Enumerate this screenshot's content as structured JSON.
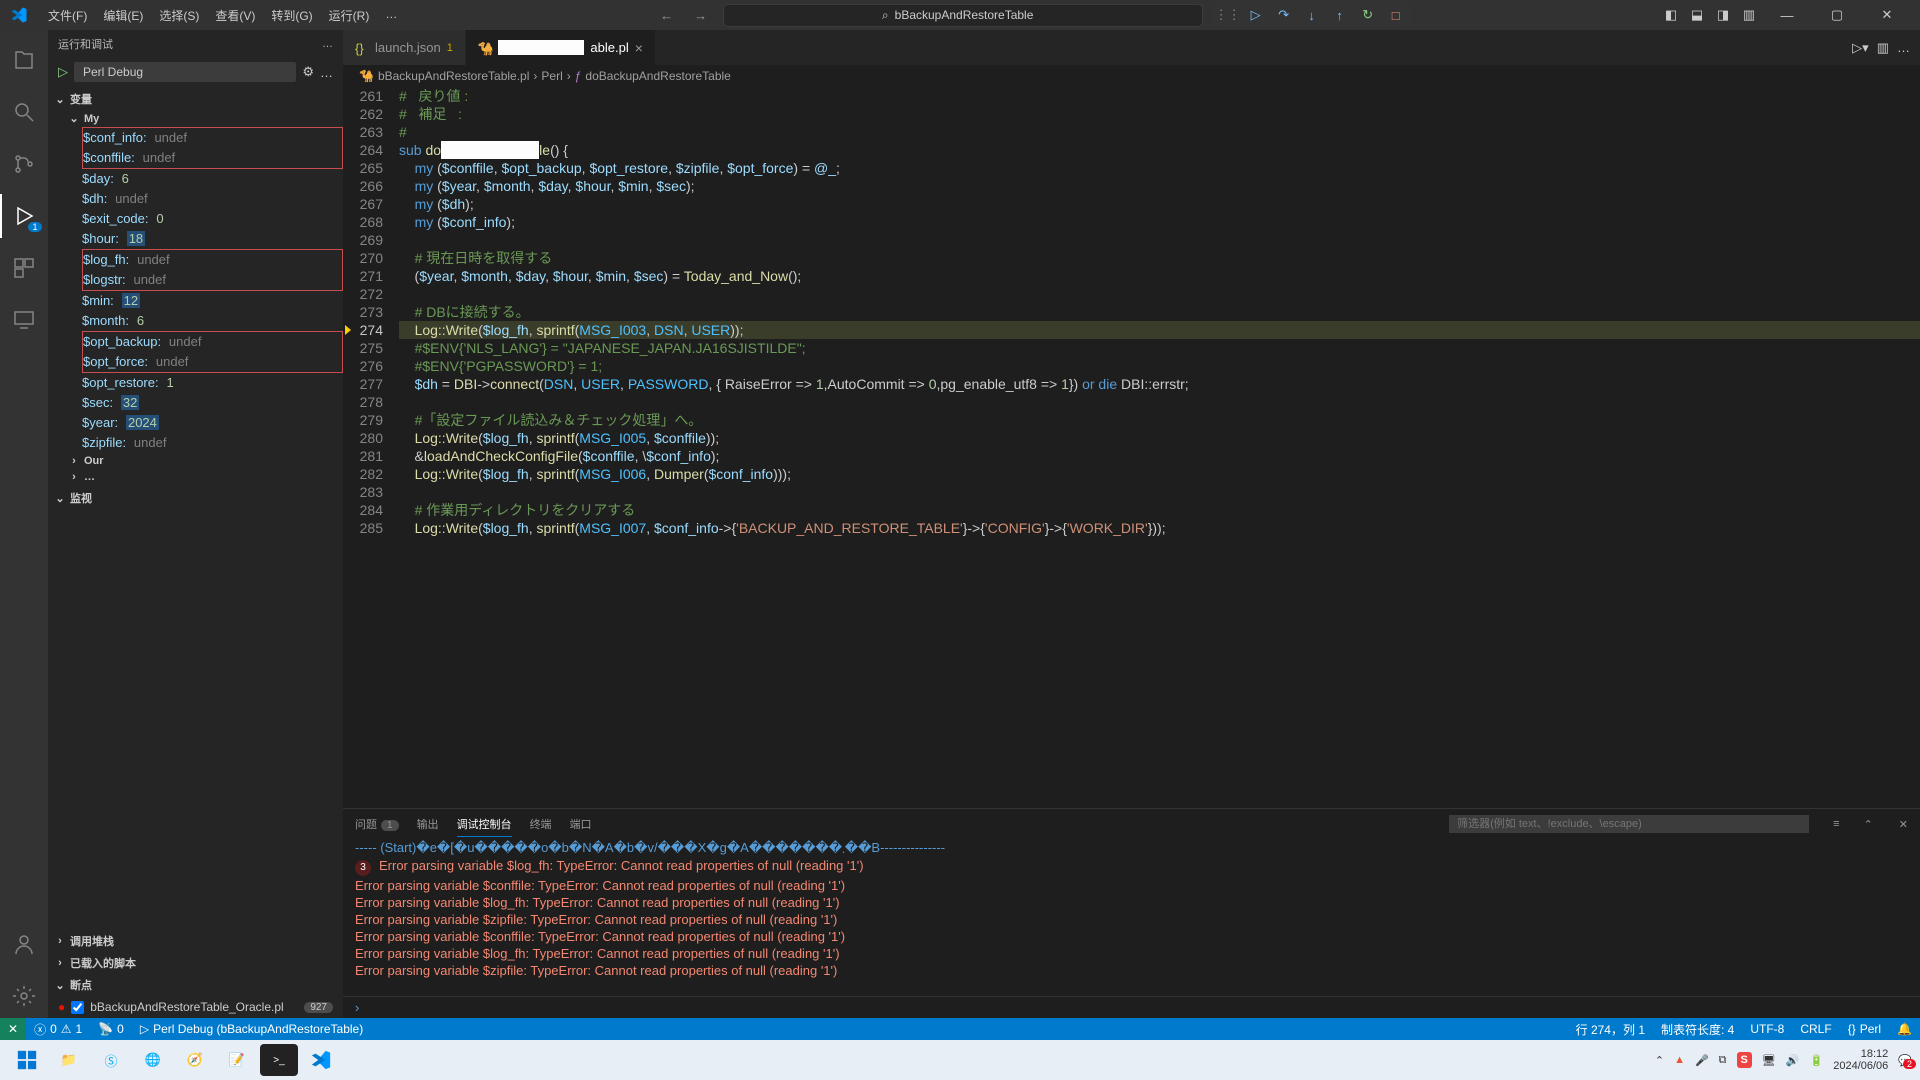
{
  "titlebar": {
    "menus": [
      "文件(F)",
      "编辑(E)",
      "选择(S)",
      "查看(V)",
      "转到(G)",
      "运行(R)",
      "…"
    ],
    "search_text": "bBackupAndRestoreTable"
  },
  "sidebar": {
    "title": "运行和调试",
    "config": "Perl Debug",
    "sections": {
      "variables": "变量",
      "my": "My",
      "our": "Our",
      "watch": "监视",
      "callstack": "调用堆栈",
      "loaded": "已载入的脚本",
      "breakpoints": "断点"
    },
    "vars": [
      {
        "n": "$conf_info",
        "v": "undef",
        "t": "undef",
        "box": "top"
      },
      {
        "n": "$conffile",
        "v": "undef",
        "t": "undef",
        "box": "bot"
      },
      {
        "n": "$day",
        "v": "6",
        "t": "num"
      },
      {
        "n": "$dh",
        "v": "undef",
        "t": "undef"
      },
      {
        "n": "$exit_code",
        "v": "0",
        "t": "num"
      },
      {
        "n": "$hour",
        "v": "18",
        "t": "num",
        "hl": true
      },
      {
        "n": "$log_fh",
        "v": "undef",
        "t": "undef",
        "box": "top"
      },
      {
        "n": "$logstr",
        "v": "undef",
        "t": "undef",
        "box": "bot"
      },
      {
        "n": "$min",
        "v": "12",
        "t": "num",
        "hl": true
      },
      {
        "n": "$month",
        "v": "6",
        "t": "num"
      },
      {
        "n": "$opt_backup",
        "v": "undef",
        "t": "undef",
        "box": "top"
      },
      {
        "n": "$opt_force",
        "v": "undef",
        "t": "undef",
        "box": "bot"
      },
      {
        "n": "$opt_restore",
        "v": "1",
        "t": "num"
      },
      {
        "n": "$sec",
        "v": "32",
        "t": "num",
        "hl": true
      },
      {
        "n": "$year",
        "v": "2024",
        "t": "num",
        "hl": true
      },
      {
        "n": "$zipfile",
        "v": "undef",
        "t": "undef"
      }
    ],
    "breakpoint_file": "bBackupAndRestoreTable_Oracle.pl",
    "breakpoint_count": "927"
  },
  "tabs": [
    {
      "icon": "json",
      "label": "launch.json",
      "mod": "1",
      "active": false
    },
    {
      "icon": "perl",
      "label": "able.pl",
      "active": true,
      "close": true,
      "masked": true
    }
  ],
  "breadcrumb": [
    "bBackupAndRestoreTable.pl",
    "Perl",
    "doBackupAndRestoreTable"
  ],
  "code": {
    "start": 261,
    "current": 274,
    "lines": [
      {
        "n": 261,
        "h": "<span class='k-com'>#   戻り値 :</span>"
      },
      {
        "n": 262,
        "h": "<span class='k-com'>#   補足   :</span>"
      },
      {
        "n": 263,
        "h": "<span class='k-com'>#</span>"
      },
      {
        "n": 264,
        "h": "<span class='k-blue'>sub</span> <span class='k-fn'>do</span><span class='whitebox'>============</span><span class='k-fn'>le</span>() {"
      },
      {
        "n": 265,
        "h": "    <span class='k-blue'>my</span> (<span class='k-var'>$conffile</span>, <span class='k-var'>$opt_backup</span>, <span class='k-var'>$opt_restore</span>, <span class='k-var'>$zipfile</span>, <span class='k-var'>$opt_force</span>) = <span class='k-var'>@_</span>;"
      },
      {
        "n": 266,
        "h": "    <span class='k-blue'>my</span> (<span class='k-var'>$year</span>, <span class='k-var'>$month</span>, <span class='k-var'>$day</span>, <span class='k-var'>$hour</span>, <span class='k-var'>$min</span>, <span class='k-var'>$sec</span>);"
      },
      {
        "n": 267,
        "h": "    <span class='k-blue'>my</span> (<span class='k-var'>$dh</span>);"
      },
      {
        "n": 268,
        "h": "    <span class='k-blue'>my</span> (<span class='k-var'>$conf_info</span>);"
      },
      {
        "n": 269,
        "h": ""
      },
      {
        "n": 270,
        "h": "    <span class='k-com'># 現在日時を取得する</span>"
      },
      {
        "n": 271,
        "h": "    (<span class='k-var'>$year</span>, <span class='k-var'>$month</span>, <span class='k-var'>$day</span>, <span class='k-var'>$hour</span>, <span class='k-var'>$min</span>, <span class='k-var'>$sec</span>) = <span class='k-fn'>Today_and_Now</span>();"
      },
      {
        "n": 272,
        "h": ""
      },
      {
        "n": 273,
        "h": "    <span class='k-com'># DBに接続する。</span>"
      },
      {
        "n": 274,
        "h": "    <span class='k-fn'>Log::Write</span>(<span class='k-var'>$log_fh</span>, <span class='k-fn'>sprintf</span>(<span class='k-const'>MSG_I003</span>, <span class='k-const'>DSN</span>, <span class='k-const'>USER</span>));",
        "cur": true
      },
      {
        "n": 275,
        "h": "    <span class='k-com'>#$ENV{'NLS_LANG'} = \"JAPANESE_JAPAN.JA16SJISTILDE\";</span>"
      },
      {
        "n": 276,
        "h": "    <span class='k-com'>#$ENV{'PGPASSWORD'} = 1;</span>"
      },
      {
        "n": 277,
        "h": "    <span class='k-var'>$dh</span> = <span class='k-fn'>DBI</span>-><span class='k-fn'>connect</span>(<span class='k-const'>DSN</span>, <span class='k-const'>USER</span>, <span class='k-const'>PASSWORD</span>, { RaiseError => <span class='k-num'>1</span>,AutoCommit => <span class='k-num'>0</span>,pg_enable_utf8 => <span class='k-num'>1</span>}) <span class='k-blue'>or die</span> DBI::errstr;"
      },
      {
        "n": 278,
        "h": ""
      },
      {
        "n": 279,
        "h": "    <span class='k-com'>#「設定ファイル読込み＆チェック処理」へ。</span>"
      },
      {
        "n": 280,
        "h": "    <span class='k-fn'>Log::Write</span>(<span class='k-var'>$log_fh</span>, <span class='k-fn'>sprintf</span>(<span class='k-const'>MSG_I005</span>, <span class='k-var'>$conffile</span>));"
      },
      {
        "n": 281,
        "h": "    &<span class='k-fn'>loadAndCheckConfigFile</span>(<span class='k-var'>$conffile</span>, \\<span class='k-var'>$conf_info</span>);"
      },
      {
        "n": 282,
        "h": "    <span class='k-fn'>Log::Write</span>(<span class='k-var'>$log_fh</span>, <span class='k-fn'>sprintf</span>(<span class='k-const'>MSG_I006</span>, <span class='k-fn'>Dumper</span>(<span class='k-var'>$conf_info</span>)));"
      },
      {
        "n": 283,
        "h": ""
      },
      {
        "n": 284,
        "h": "    <span class='k-com'># 作業用ディレクトリをクリアする</span>"
      },
      {
        "n": 285,
        "h": "    <span class='k-fn'>Log::Write</span>(<span class='k-var'>$log_fh</span>, <span class='k-fn'>sprintf</span>(<span class='k-const'>MSG_I007</span>, <span class='k-var'>$conf_info</span>->{<span class='k-str'>'BACKUP_AND_RESTORE_TABLE'</span>}->{<span class='k-str'>'CONFIG'</span>}->{<span class='k-str'>'WORK_DIR'</span>}));"
      }
    ]
  },
  "panel": {
    "tabs": {
      "problems": "问题",
      "problems_count": "1",
      "output": "输出",
      "debug_console": "调试控制台",
      "terminal": "终端",
      "ports": "端口"
    },
    "filter_placeholder": "筛选器(例如 text、!exclude、\\escape)",
    "lines": [
      {
        "cls": "startline",
        "t": "----- (Start)�e�[�u�����o�b�N�A�b�v/���X�g�A�������܂��B---------------"
      },
      {
        "cls": "",
        "badge": "3",
        "t": "Error parsing variable $log_fh: TypeError: Cannot read properties of null (reading '1')"
      },
      {
        "cls": "",
        "t": "Error parsing variable $conffile: TypeError: Cannot read properties of null (reading '1')"
      },
      {
        "cls": "",
        "t": "Error parsing variable $log_fh: TypeError: Cannot read properties of null (reading '1')"
      },
      {
        "cls": "",
        "t": "Error parsing variable $zipfile: TypeError: Cannot read properties of null (reading '1')"
      },
      {
        "cls": "",
        "t": "Error parsing variable $conffile: TypeError: Cannot read properties of null (reading '1')"
      },
      {
        "cls": "",
        "t": "Error parsing variable $log_fh: TypeError: Cannot read properties of null (reading '1')"
      },
      {
        "cls": "",
        "t": "Error parsing variable $zipfile: TypeError: Cannot read properties of null (reading '1')"
      }
    ]
  },
  "statusbar": {
    "errors": "0",
    "warnings": "1",
    "ports": "0",
    "debug": "Perl Debug (bBackupAndRestoreTable)",
    "pos": "行 274，列 1",
    "tab": "制表符长度: 4",
    "enc": "UTF-8",
    "eol": "CRLF",
    "lang": "Perl"
  },
  "taskbar": {
    "time": "18:12",
    "date": "2024/06/06"
  }
}
